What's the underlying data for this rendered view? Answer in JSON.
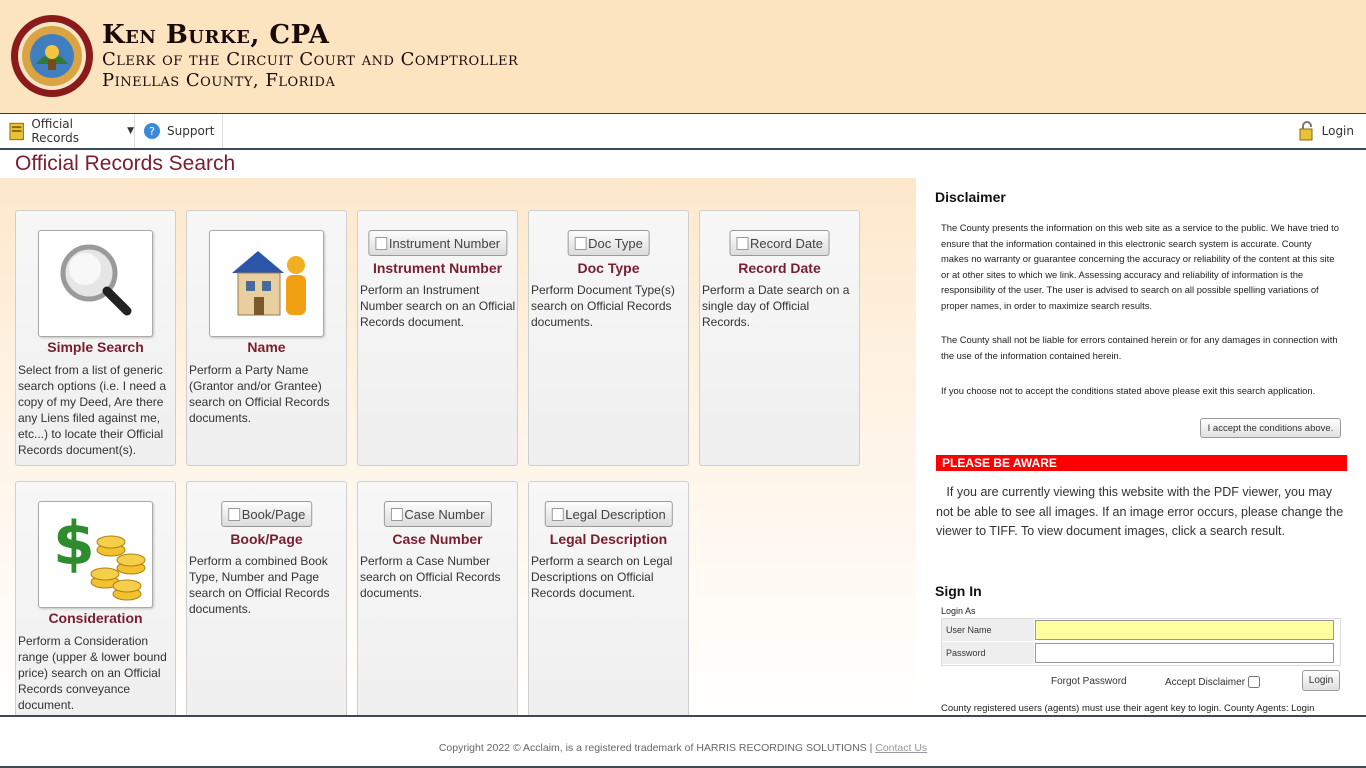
{
  "header": {
    "name": "Ken Burke, CPA",
    "title": "Clerk of the Circuit Court and Comptroller",
    "county": "Pinellas County, Florida"
  },
  "nav": {
    "records_label": "Official Records",
    "support_label": "Support",
    "login_label": "Login"
  },
  "page_title": "Official Records Search",
  "cards": [
    {
      "title": "Simple Search",
      "desc": "Select from a list of generic search options (i.e. I need a copy of my Deed, Are there any Liens filed against me, etc...) to locate their Official Records document(s).",
      "icon": "magnifier-icon"
    },
    {
      "title": "Name",
      "desc": "Perform a Party Name (Grantor and/or Grantee) search on Official Records documents.",
      "icon": "house-person-icon"
    },
    {
      "title": "Instrument Number",
      "button": "Instrument Number",
      "desc": "Perform an Instrument Number search on an Official Records document."
    },
    {
      "title": "Doc Type",
      "button": "Doc Type",
      "desc": "Perform Document Type(s) search on Official Records documents."
    },
    {
      "title": "Record Date",
      "button": "Record Date",
      "desc": "Perform a Date search on a single day of Official Records."
    },
    {
      "title": "Consideration",
      "desc": "Perform a Consideration range (upper & lower bound price) search on an Official Records conveyance document.",
      "icon": "dollar-coins-icon"
    },
    {
      "title": "Book/Page",
      "button": "Book/Page",
      "desc": "Perform a combined Book Type, Number and Page search on Official Records documents."
    },
    {
      "title": "Case Number",
      "button": "Case Number",
      "desc": "Perform a Case Number search on Official Records documents."
    },
    {
      "title": "Legal Description",
      "button": "Legal Description",
      "desc": "Perform a search on Legal Descriptions on Official Records document."
    }
  ],
  "disclaimer": {
    "heading": "Disclaimer",
    "p1": "The County presents the information on this web site as a service to the public. We have tried to ensure that the information contained in this electronic search system is accurate. County makes no warranty or guarantee concerning the accuracy or reliability of the content at this site or at other sites to which we link. Assessing accuracy and reliability of information is the responsibility of the user. The user is advised to search on all possible spelling variations of proper names, in order to maximize search results.",
    "p2": "The County shall not be liable for errors contained herein or for any damages in connection with the use of the information contained herein.",
    "p3": "If you choose not to accept the conditions stated above please exit this search application.",
    "accept_button": "I accept the conditions above."
  },
  "aware": {
    "heading": "PLEASE BE AWARE",
    "text": "If you are currently viewing this website with the PDF viewer, you may not be able to see all images. If an image error occurs, please change the viewer to TIFF. To view document images, click a search result."
  },
  "signin": {
    "heading": "Sign In",
    "login_as": "Login As",
    "username_label": "User Name",
    "password_label": "Password",
    "forgot": "Forgot Password",
    "accept_disclaimer": "Accept Disclaimer",
    "login_button": "Login",
    "agent_note": "County registered users (agents) must use their agent key to login. County Agents: Login"
  },
  "footer": {
    "copyright": "Copyright 2022 © Acclaim, is a registered trademark of HARRIS RECORDING SOLUTIONS | ",
    "contact": "Contact Us"
  },
  "colors": {
    "header_bg": "#fde4c1",
    "accent": "#7a1e2e",
    "aware_red": "#ff0000"
  }
}
